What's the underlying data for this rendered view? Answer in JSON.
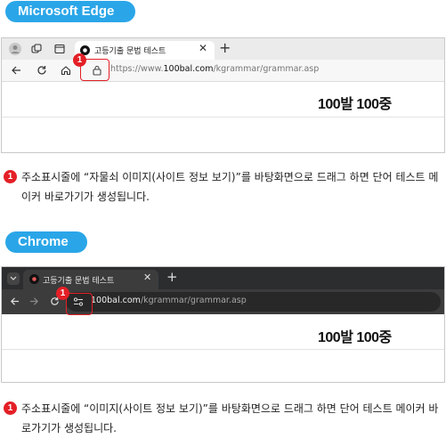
{
  "edge": {
    "badge": "Microsoft Edge",
    "tab_title": "고등기출 문법 테스트",
    "url_domain": "100bal.com",
    "url_prefix": "https://www.",
    "url_path": "/kgrammar/grammar.asp",
    "logo": "100발 100중",
    "callout_number": "1",
    "instruction_number": "1",
    "instruction": "주소표시줄에 “자물쇠 이미지(사이트 정보 보기)”를 바탕화면으로 드래그 하면 단어 테스트 메이커 바로가기가 생성됩니다."
  },
  "chrome": {
    "badge": "Chrome",
    "tab_title": "고등기출 문법 테스트",
    "url_domain": "100bal.com",
    "url_path": "/kgrammar/grammar.asp",
    "logo": "100발 100중",
    "callout_number": "1",
    "instruction_number": "1",
    "instruction": "주소표시줄에 “이미지(사이트 정보 보기)”를 바탕화면으로 드래그 하면 단어 테스트 메이커 바로가기가 생성됩니다."
  },
  "colors": {
    "pill": "#2aa6e8",
    "callout": "#e41f26",
    "chrome_dark": "#3c3c3c",
    "edge_toolbar": "#f3f3f3"
  }
}
